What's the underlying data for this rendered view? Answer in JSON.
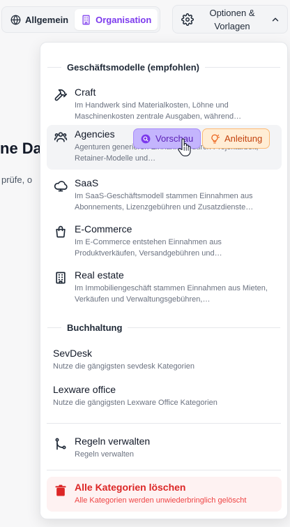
{
  "tabs": [
    {
      "label": "Allgemein",
      "icon": "globe-icon",
      "active": false
    },
    {
      "label": "Organisation",
      "icon": "building-icon",
      "active": true
    }
  ],
  "options_button": {
    "label": "Optionen & Vorlagen",
    "icon": "gear-icon",
    "chevron": "chevron-up-icon"
  },
  "background": {
    "heading_fragment": "ne Da",
    "text_fragment": "prüfe, o"
  },
  "menu": {
    "business_models": {
      "title": "Geschäftsmodelle (empfohlen)",
      "items": [
        {
          "title": "Craft",
          "desc": "Im Handwerk sind Materialkosten, Löhne und Maschinenkosten zentrale Ausgaben, während…",
          "icon": "hammer-icon"
        },
        {
          "title": "Agencies",
          "desc": "Agenturen generieren Einnahmen durch Projektarbeit, Retainer-Modelle und…",
          "icon": "users-icon"
        },
        {
          "title": "SaaS",
          "desc": "Im SaaS-Geschäftsmodell stammen Einnahmen aus Abonnements, Lizenzgebühren und Zusatzdienste…",
          "icon": "cloud-icon"
        },
        {
          "title": "E-Commerce",
          "desc": "Im E-Commerce entstehen Einnahmen aus Produktverkäufen, Versandgebühren und…",
          "icon": "shopping-bag-icon"
        },
        {
          "title": "Real estate",
          "desc": "Im Immobiliengeschäft stammen Einnahmen aus Mieten, Verkäufen und Verwaltungsgebühren,…",
          "icon": "building-icon"
        }
      ],
      "preview_label": "Vorschau",
      "guide_label": "Anleitung"
    },
    "accounting": {
      "title": "Buchhaltung",
      "items": [
        {
          "title": "SevDesk",
          "desc": "Nutze die gängigsten sevdesk Kategorien"
        },
        {
          "title": "Lexware office",
          "desc": "Nutze die gängigsten Lexware Office Kategorien"
        }
      ]
    },
    "rules": {
      "title": "Regeln verwalten",
      "desc": "Regeln verwalten",
      "icon": "git-branch-icon"
    },
    "delete_all": {
      "title": "Alle Kategorien löschen",
      "desc": "Alle Kategorien werden unwiederbringlich gelöscht",
      "icon": "trash-icon"
    }
  },
  "colors": {
    "accent": "#7c3aed",
    "danger": "#dc2626",
    "guide": "#ea580c"
  }
}
